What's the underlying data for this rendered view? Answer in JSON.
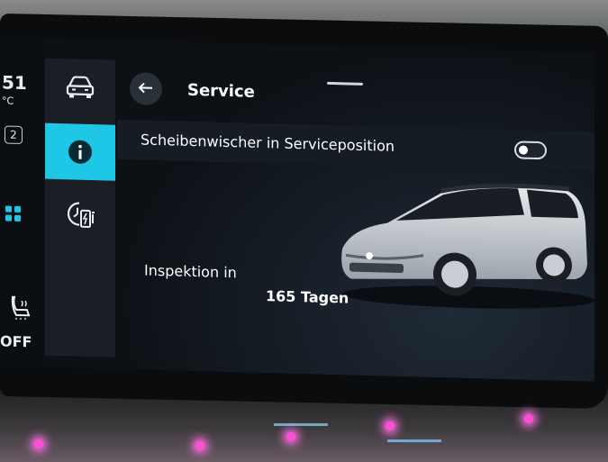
{
  "status": {
    "temperature": "51",
    "temperature_unit": "°C",
    "count": "2",
    "seat_heating_state": "OFF"
  },
  "rail": {
    "items": [
      {
        "name": "vehicle",
        "icon": "car-icon",
        "active": false
      },
      {
        "name": "info",
        "icon": "info-icon",
        "active": true
      },
      {
        "name": "charging",
        "icon": "charging-timer-icon",
        "active": false
      }
    ]
  },
  "header": {
    "title": "Service"
  },
  "settings": {
    "wiper_service_label": "Scheibenwischer in Serviceposition",
    "wiper_service_enabled": false
  },
  "inspection": {
    "label": "Inspektion in",
    "value": "165 Tagen"
  },
  "colors": {
    "accent": "#1fc7e6",
    "background": "#0d1116",
    "rail": "#1a1f26",
    "text": "#ffffff"
  }
}
